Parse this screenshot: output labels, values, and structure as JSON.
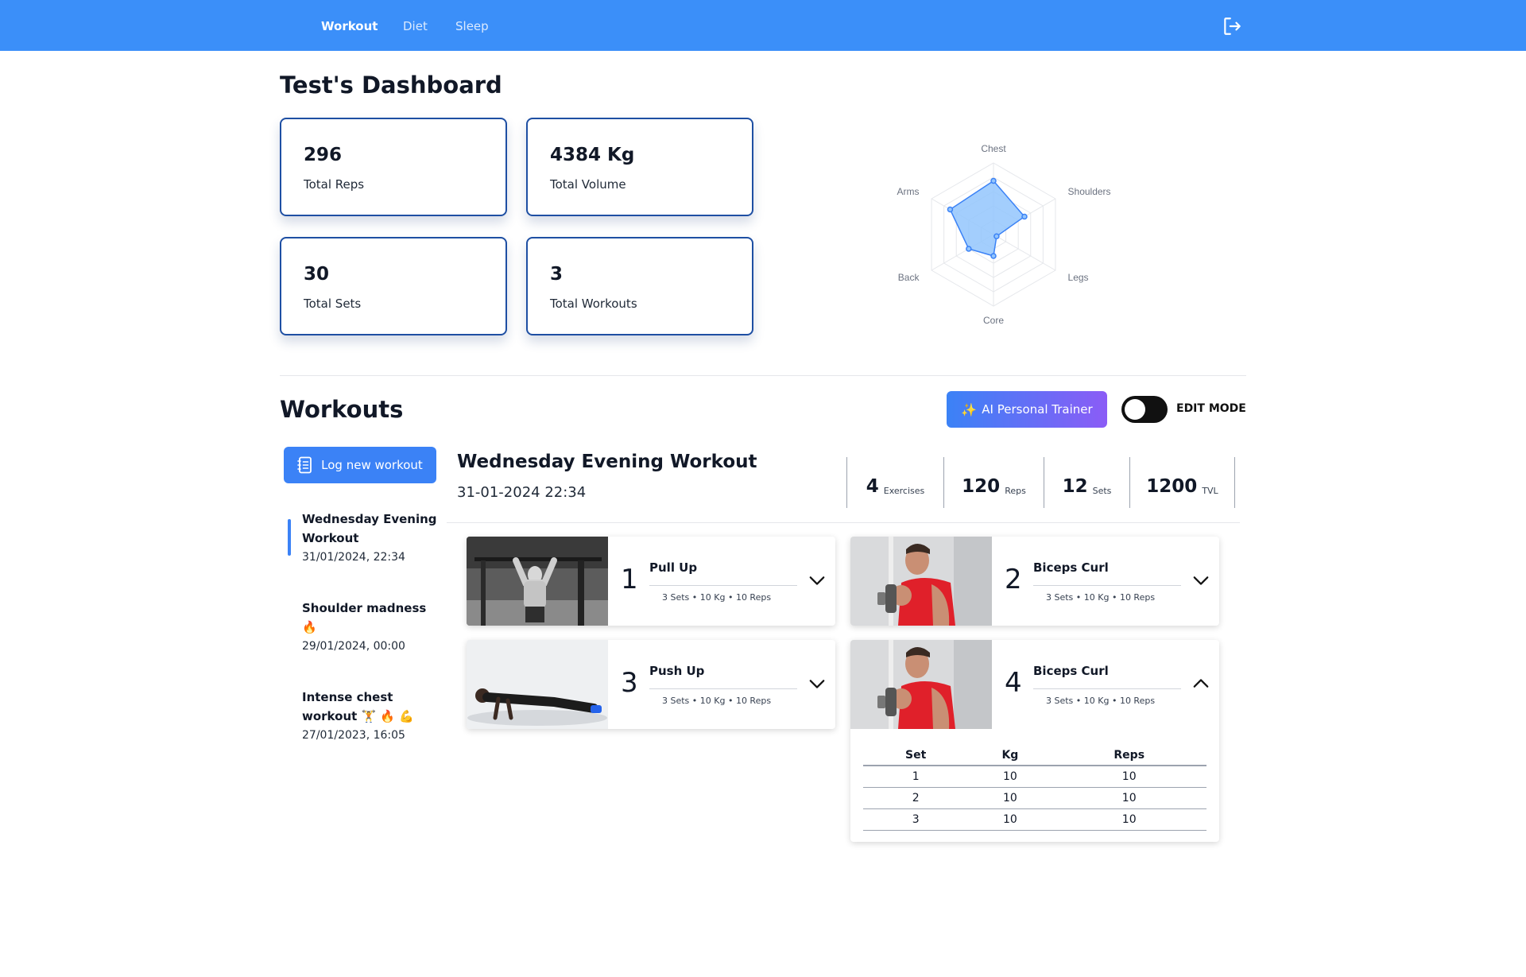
{
  "nav": {
    "links": [
      "Workout",
      "Diet",
      "Sleep"
    ],
    "logout_icon": "logout-icon"
  },
  "dashboard": {
    "title": "Test's Dashboard",
    "stats": [
      {
        "value": "296",
        "label": "Total Reps"
      },
      {
        "value": "4384 Kg",
        "label": "Total Volume"
      },
      {
        "value": "30",
        "label": "Total Sets"
      },
      {
        "value": "3",
        "label": "Total Workouts"
      }
    ],
    "radar": {
      "axes": [
        "Chest",
        "Shoulders",
        "Legs",
        "Core",
        "Back",
        "Arms"
      ],
      "values": [
        0.75,
        0.5,
        0.05,
        0.3,
        0.4,
        0.7
      ],
      "rings": 5,
      "fill_color": "#93c5fd",
      "stroke_color": "#3b82f6"
    }
  },
  "workouts": {
    "title": "Workouts",
    "ai_button_label": "AI Personal Trainer",
    "ai_icon": "sparkles-icon",
    "edit_mode_label": "EDIT MODE",
    "edit_mode_on": false,
    "log_button_label": "Log new workout",
    "log_icon": "notebook-icon",
    "list": [
      {
        "title": "Wednesday Evening Workout",
        "date": "31/01/2024, 22:34",
        "active": true
      },
      {
        "title": "Shoulder madness 🔥",
        "date": "29/01/2024, 00:00",
        "active": false
      },
      {
        "title": "Intense chest workout 🏋️ 🔥 💪",
        "date": "27/01/2023, 16:05",
        "active": false
      }
    ]
  },
  "detail": {
    "title": "Wednesday Evening Workout",
    "date": "31-01-2024 22:34",
    "stats": [
      {
        "num": "4",
        "unit": "Exercises"
      },
      {
        "num": "120",
        "unit": "Reps"
      },
      {
        "num": "12",
        "unit": "Sets"
      },
      {
        "num": "1200",
        "unit": "TVL"
      }
    ],
    "exercises": [
      {
        "index": "1",
        "name": "Pull Up",
        "meta": "3 Sets  •  10 Kg  •  10 Reps",
        "expanded": false,
        "image": "pull-up-photo"
      },
      {
        "index": "2",
        "name": "Biceps Curl",
        "meta": "3 Sets  •  10 Kg  •  10 Reps",
        "expanded": false,
        "image": "biceps-curl-photo"
      },
      {
        "index": "3",
        "name": "Push Up",
        "meta": "3 Sets  •  10 Kg  •  10 Reps",
        "expanded": false,
        "image": "push-up-photo"
      },
      {
        "index": "4",
        "name": "Biceps Curl",
        "meta": "3 Sets  •  10 Kg  •  10 Reps",
        "expanded": true,
        "image": "biceps-curl-photo"
      }
    ],
    "set_table": {
      "headers": [
        "Set",
        "Kg",
        "Reps"
      ],
      "rows": [
        [
          "1",
          "10",
          "10"
        ],
        [
          "2",
          "10",
          "10"
        ],
        [
          "3",
          "10",
          "10"
        ]
      ]
    }
  }
}
